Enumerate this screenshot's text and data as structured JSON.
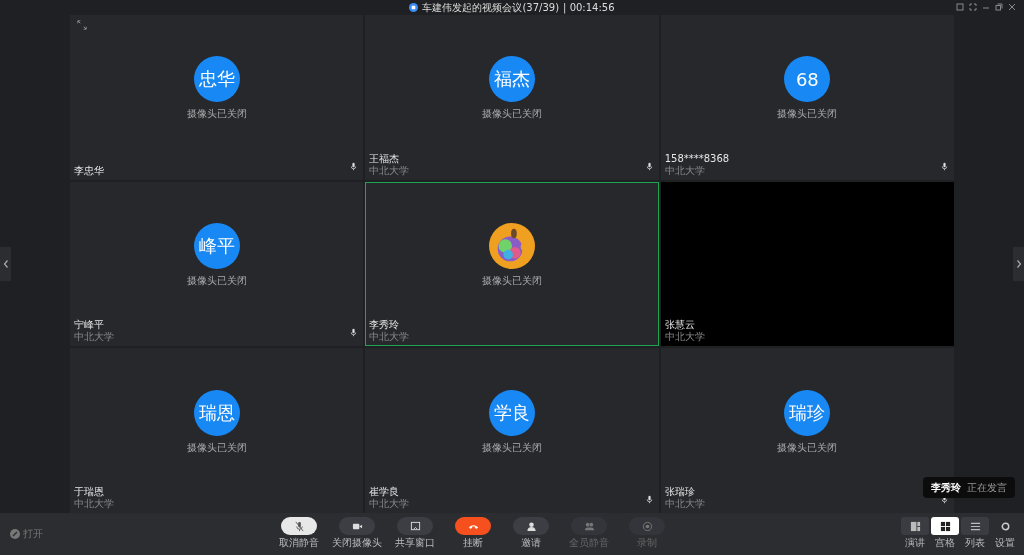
{
  "window": {
    "title": "车建伟发起的视频会议(37/39)",
    "timer": "| 00:14:56"
  },
  "tiles": [
    {
      "kind": "initials",
      "avatar": "忠华",
      "caption": "摄像头已关闭",
      "name": "李忠华",
      "mic": true,
      "selected": false
    },
    {
      "kind": "initials",
      "avatar": "福杰",
      "caption": "摄像头已关闭",
      "name": "王福杰",
      "org": "中北大学",
      "mic": true,
      "selected": false
    },
    {
      "kind": "initials",
      "avatar": "68",
      "caption": "摄像头已关闭",
      "name": "158****8368",
      "org": "中北大学",
      "mic": true,
      "selected": false
    },
    {
      "kind": "initials",
      "avatar": "峰平",
      "caption": "摄像头已关闭",
      "name": "宁峰平",
      "org": "中北大学",
      "mic": true,
      "selected": false
    },
    {
      "kind": "picture",
      "caption": "摄像头已关闭",
      "name": "李秀玲",
      "org": "中北大学",
      "mic": false,
      "selected": true
    },
    {
      "kind": "video",
      "name": "张慧云",
      "org": "中北大学",
      "mic": false,
      "selected": false
    },
    {
      "kind": "initials",
      "avatar": "瑞恩",
      "caption": "摄像头已关闭",
      "name": "于瑞恩",
      "org": "中北大学",
      "mic": false,
      "selected": false
    },
    {
      "kind": "initials",
      "avatar": "学良",
      "caption": "摄像头已关闭",
      "name": "崔学良",
      "org": "中北大学",
      "mic": true,
      "selected": false
    },
    {
      "kind": "initials",
      "avatar": "瑞珍",
      "caption": "摄像头已关闭",
      "name": "张瑞珍",
      "org": "中北大学",
      "mic": true,
      "selected": false
    }
  ],
  "speaking": {
    "name": "李秀玲",
    "status": "正在发言"
  },
  "signal": {
    "label": "打开"
  },
  "controls": [
    {
      "kind": "mic",
      "label": "取消静音",
      "active": true,
      "disabled": false
    },
    {
      "kind": "camera",
      "label": "关闭摄像头",
      "active": false,
      "disabled": false
    },
    {
      "kind": "share",
      "label": "共享窗口",
      "active": false,
      "disabled": false
    },
    {
      "kind": "hangup",
      "label": "挂断",
      "active": false,
      "disabled": false
    },
    {
      "kind": "invite",
      "label": "邀请",
      "active": false,
      "disabled": false
    },
    {
      "kind": "muteall",
      "label": "全员静音",
      "active": false,
      "disabled": true
    },
    {
      "kind": "record",
      "label": "录制",
      "active": false,
      "disabled": true
    }
  ],
  "layouts": [
    {
      "kind": "speaker",
      "label": "演讲",
      "selected": false
    },
    {
      "kind": "grid",
      "label": "宫格",
      "selected": true
    },
    {
      "kind": "list",
      "label": "列表",
      "selected": false
    }
  ],
  "settings": {
    "label": "设置"
  }
}
